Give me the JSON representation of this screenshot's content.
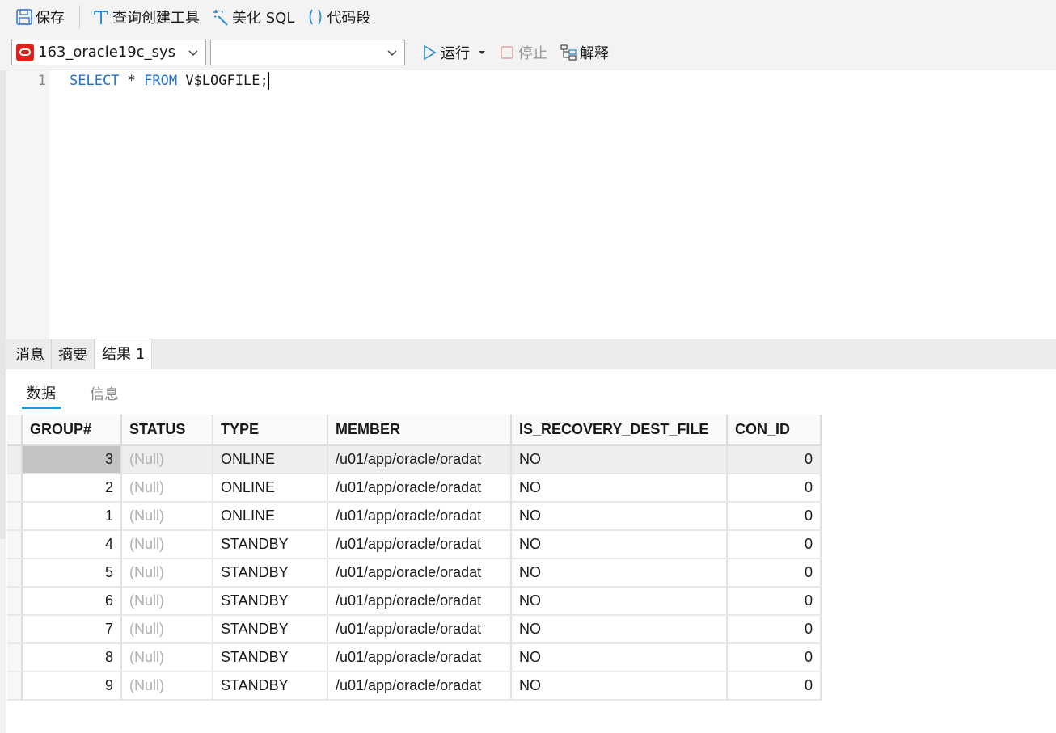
{
  "toolbar": {
    "save_label": "保存",
    "query_builder_label": "查询创建工具",
    "beautify_label": "美化 SQL",
    "snippet_label": "代码段"
  },
  "connection": {
    "name": "163_oracle19c_sys",
    "database": ""
  },
  "actions": {
    "run_label": "运行",
    "stop_label": "停止",
    "explain_label": "解释"
  },
  "editor": {
    "line_number": "1",
    "kw_select": "SELECT",
    "star": " * ",
    "kw_from": "FROM",
    "rest": " V$LOGFILE;"
  },
  "result_tabs": [
    "消息",
    "摘要",
    "结果 1"
  ],
  "sub_tabs": [
    "数据",
    "信息"
  ],
  "grid": {
    "columns": [
      "GROUP#",
      "STATUS",
      "TYPE",
      "MEMBER",
      "IS_RECOVERY_DEST_FILE",
      "CON_ID"
    ],
    "rows": [
      [
        "3",
        "(Null)",
        "ONLINE",
        "/u01/app/oracle/oradat",
        "NO",
        "0"
      ],
      [
        "2",
        "(Null)",
        "ONLINE",
        "/u01/app/oracle/oradat",
        "NO",
        "0"
      ],
      [
        "1",
        "(Null)",
        "ONLINE",
        "/u01/app/oracle/oradat",
        "NO",
        "0"
      ],
      [
        "4",
        "(Null)",
        "STANDBY",
        "/u01/app/oracle/oradat",
        "NO",
        "0"
      ],
      [
        "5",
        "(Null)",
        "STANDBY",
        "/u01/app/oracle/oradat",
        "NO",
        "0"
      ],
      [
        "6",
        "(Null)",
        "STANDBY",
        "/u01/app/oracle/oradat",
        "NO",
        "0"
      ],
      [
        "7",
        "(Null)",
        "STANDBY",
        "/u01/app/oracle/oradat",
        "NO",
        "0"
      ],
      [
        "8",
        "(Null)",
        "STANDBY",
        "/u01/app/oracle/oradat",
        "NO",
        "0"
      ],
      [
        "9",
        "(Null)",
        "STANDBY",
        "/u01/app/oracle/oradat",
        "NO",
        "0"
      ]
    ]
  },
  "colors": {
    "keyword": "#1f6fd1",
    "accent": "#1c9ad6",
    "oracle": "#e0201b",
    "null_text": "#b0b0b0"
  }
}
